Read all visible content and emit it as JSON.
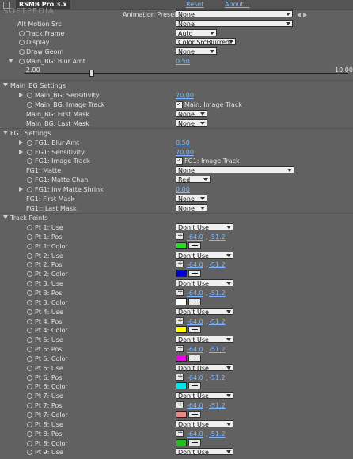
{
  "header": {
    "effect_name": "RSMB Pro 3.x",
    "reset": "Reset",
    "about": "About...",
    "watermark": "SOFTPEDIA",
    "animation_presets_label": "Animation Presets:",
    "animation_presets_value": "None"
  },
  "alt_motion_src": {
    "label": "Alt Motion Src",
    "value": "None"
  },
  "track_frame": {
    "label": "Track Frame",
    "value": "Auto"
  },
  "display": {
    "label": "Display",
    "value": "Color SrcBlurred"
  },
  "draw_geom": {
    "label": "Draw Geom",
    "value": "None"
  },
  "main_bg_blur": {
    "label": "Main_BG: Blur Amt",
    "value": "0.50",
    "min": "-2.00",
    "max": "10.00",
    "fraction": 0.208
  },
  "main_bg_settings": {
    "title": "Main_BG Settings",
    "sensitivity": {
      "label": "Main_BG: Sensitivity",
      "value": "70.00"
    },
    "image_track": {
      "label": "Main_BG: Image Track",
      "checkbox_label": "Main: Image Track"
    },
    "first_mask": {
      "label": "Main_BG: First Mask",
      "value": "None"
    },
    "last_mask": {
      "label": "Main_BG: Last Mask",
      "value": "None"
    }
  },
  "fg1_settings": {
    "title": "FG1 Settings",
    "blur": {
      "label": "FG1: Blur Amt",
      "value": "0.50"
    },
    "sensitivity": {
      "label": "FG1: Sensitivity",
      "value": "70.00"
    },
    "image_track": {
      "label": "FG1: Image Track",
      "checkbox_label": "FG1: Image Track"
    },
    "matte": {
      "label": "FG1: Matte",
      "value": "None"
    },
    "matte_chan": {
      "label": "FG1: Matte Chan",
      "value": "Red"
    },
    "inv_matte_shrink": {
      "label": "FG1: Inv Matte Shrink",
      "value": "0.00"
    },
    "first_mask": {
      "label": "FG1: First Mask",
      "value": "None"
    },
    "last_mask": {
      "label": "FG1:: Last Mask",
      "value": "None"
    }
  },
  "track_points": {
    "title": "Track Points",
    "use_value": "Don't Use",
    "pos_x": "-64.0",
    "pos_y": "-51.2",
    "points": [
      {
        "use": "Pt 1: Use",
        "pos": "Pt 1: Pos",
        "color": "Pt 1: Color",
        "swatch": "#22dd22"
      },
      {
        "use": "Pt 2: Use",
        "pos": "Pt 2: Pos",
        "color": "Pt 2: Color",
        "swatch": "#0000cc"
      },
      {
        "use": "Pt 3: Use",
        "pos": "Pt 3: Pos",
        "color": "Pt 3: Color",
        "swatch": "#ffffff"
      },
      {
        "use": "Pt 4: Use",
        "pos": "Pt 4: Pos",
        "color": "Pt 4: Color",
        "swatch": "#ffff00"
      },
      {
        "use": "Pt 5: Use",
        "pos": "Pt 5: Pos",
        "color": "Pt 5: Color",
        "swatch": "#ee00ee"
      },
      {
        "use": "Pt 6: Use",
        "pos": "Pt 6: Pos",
        "color": "Pt 6: Color",
        "swatch": "#00e5e5"
      },
      {
        "use": "Pt 7: Use",
        "pos": "Pt 7: Pos",
        "color": "Pt 7: Color",
        "swatch": "#e58a8a"
      },
      {
        "use": "Pt 8: Use",
        "pos": "Pt 8: Pos",
        "color": "Pt 8: Color",
        "swatch": "#22bb22"
      },
      {
        "use": "Pt 9: Use"
      }
    ]
  }
}
